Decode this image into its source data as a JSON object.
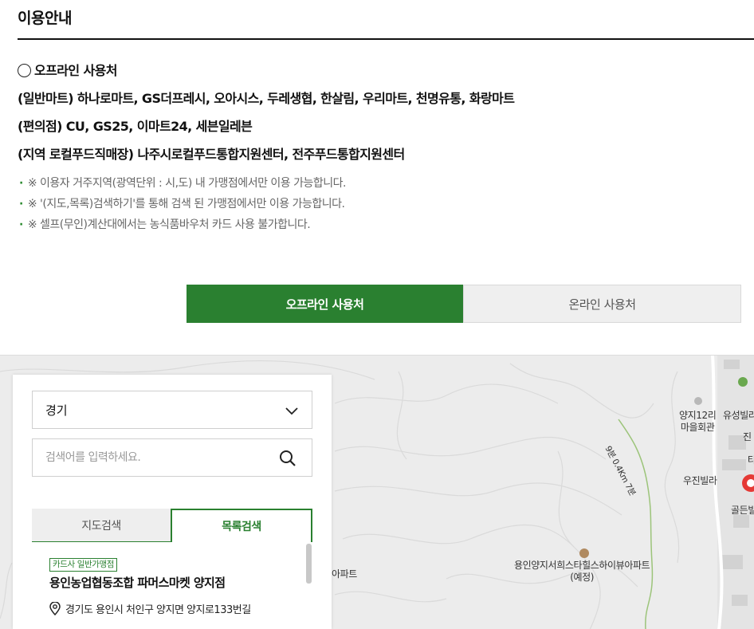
{
  "page": {
    "title": "이용안내"
  },
  "info": {
    "heading": "오프라인 사용처",
    "lines": [
      "(일반마트) 하나로마트, GS더프레시, 오아시스, 두레생협, 한살림, 우리마트, 천명유통, 화랑마트",
      "(편의점) CU, GS25, 이마트24, 세븐일레븐",
      "(지역 로컬푸드직매장) 나주시로컬푸드통합지원센터, 전주푸드통합지원센터"
    ],
    "notes": [
      "※ 이용자 거주지역(광역단위 : 시,도) 내 가맹점에서만 이용 가능합니다.",
      "※ '(지도,목록)검색하기'를 통해 검색 된 가맹점에서만 이용 가능합니다.",
      "※ 셀프(무인)계산대에서는 농식품바우처 카드 사용 불가합니다."
    ]
  },
  "tabs": {
    "offline": "오프라인 사용처",
    "online": "온라인 사용처"
  },
  "panel": {
    "region": "경기",
    "search_placeholder": "검색어를 입력하세요.",
    "subtabs": {
      "map": "지도검색",
      "list": "목록검색"
    },
    "result": {
      "badge": "카드사 일반가맹점",
      "name": "용인농업협동조합 파머스마켓 양지점",
      "address": "경기도 용인시 처인구 양지면 양지로133번길"
    }
  },
  "map": {
    "labels": {
      "village_hall_line1": "양지12리",
      "village_hall_line2": "마을회관",
      "yusung": "유성빌라",
      "jin": "진",
      "ta": "타",
      "woojin": "우진빌라",
      "golden": "골든빌",
      "apartment_line1": "용인양지서희스타힐스하이뷰아파트",
      "apartment_line2": "(예정)",
      "apart_short": "아파트",
      "walk_route": "9분 0.4Km 7분"
    },
    "colors": {
      "marker": "#e53935",
      "route": "#8fbf6a"
    }
  },
  "colors": {
    "accent": "#2a8030"
  }
}
